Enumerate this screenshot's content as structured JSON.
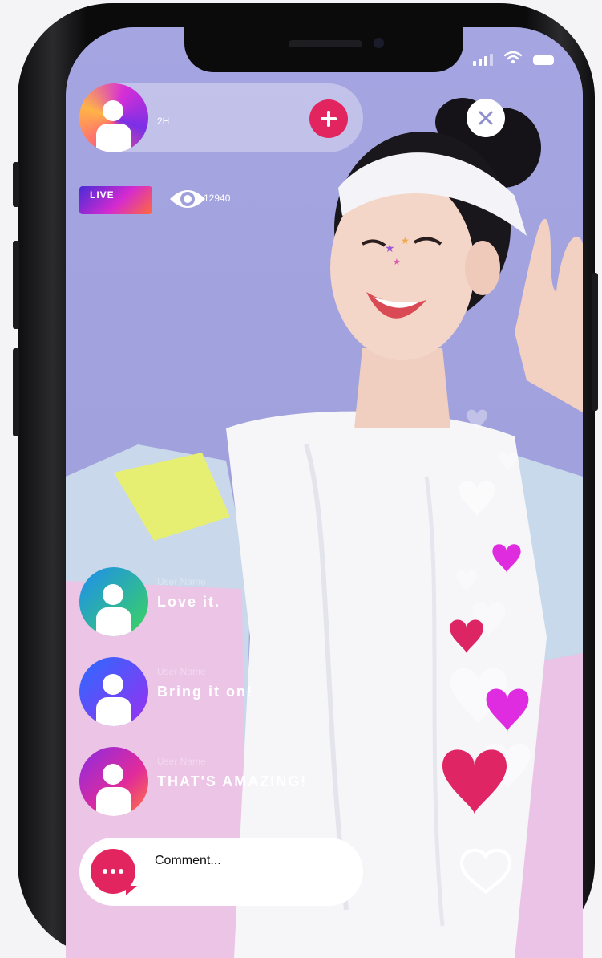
{
  "host": {
    "time": "2H"
  },
  "live": {
    "badge": "LIVE",
    "viewers": "12940"
  },
  "comments": [
    {
      "user": "User Name",
      "text": "Love it."
    },
    {
      "user": "User Name",
      "text": "Bring it on!"
    },
    {
      "user": "User Name",
      "text": "THAT'S AMAZING!"
    }
  ],
  "composer": {
    "placeholder": "Comment..."
  },
  "colors": {
    "accent": "#e2245f",
    "magenta": "#dd2bdc",
    "background": "#9f9fdc"
  },
  "icons": [
    "signal-icon",
    "wifi-icon",
    "battery-icon",
    "plus-icon",
    "close-icon",
    "eye-icon",
    "chat-bubble-icon",
    "heart-outline-icon",
    "heart-icon"
  ]
}
